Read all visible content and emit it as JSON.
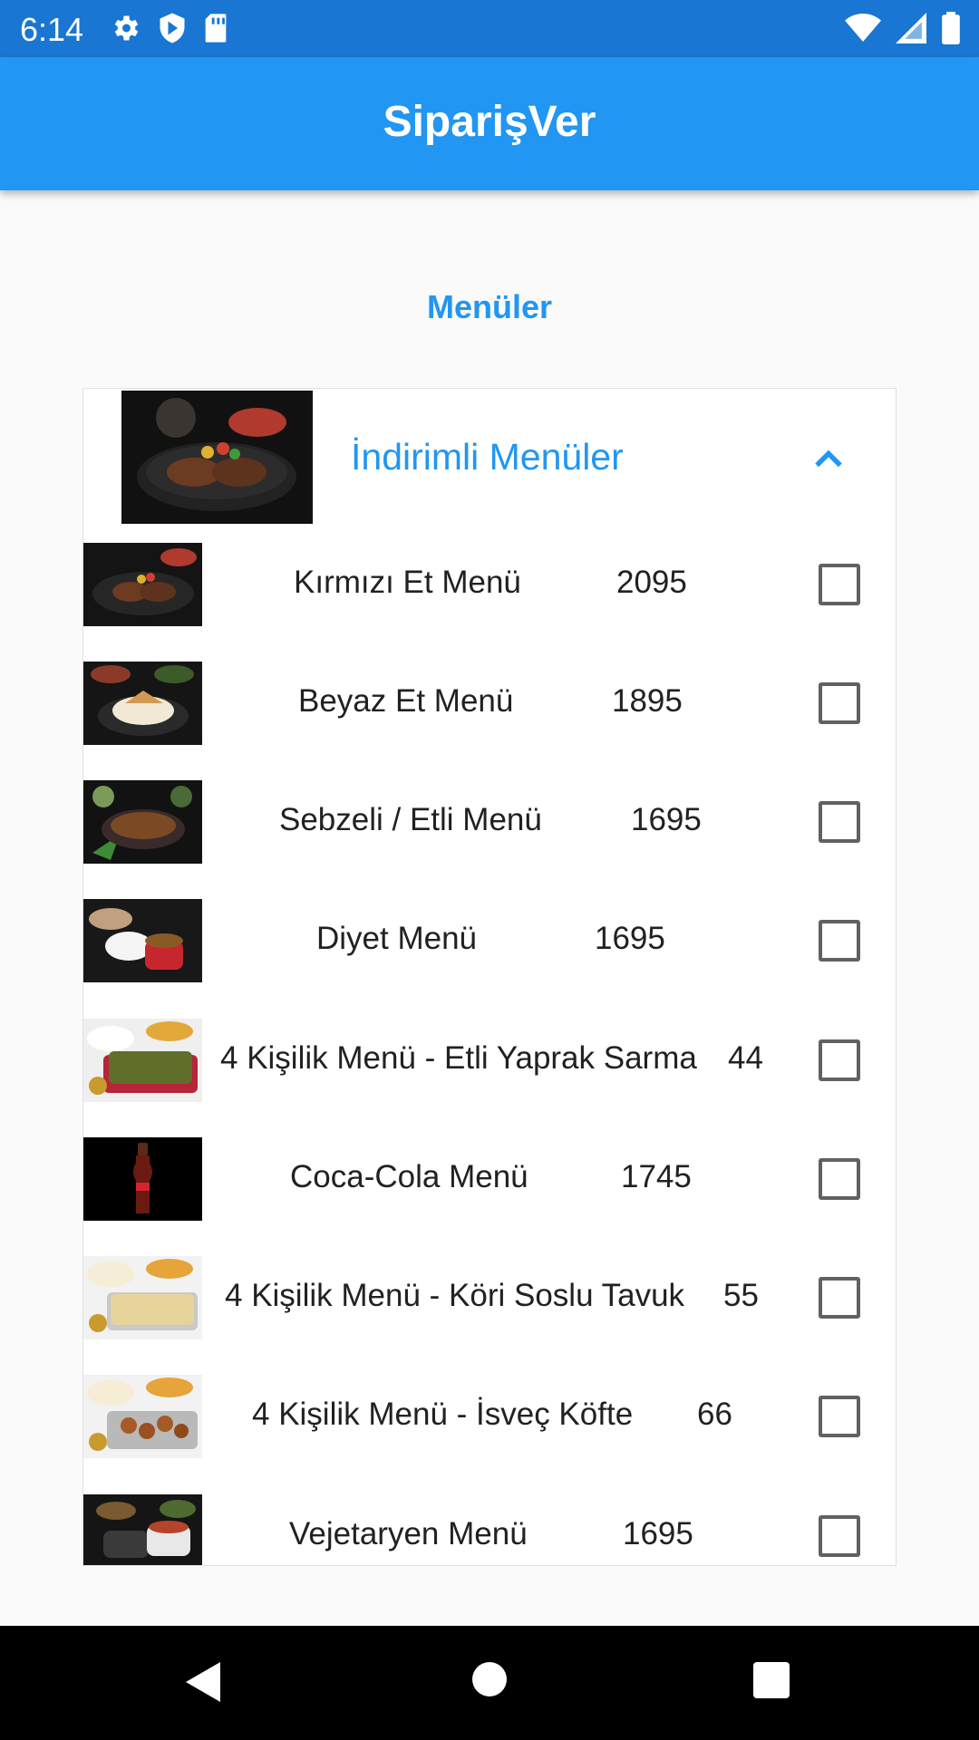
{
  "status_bar": {
    "time": "6:14",
    "left_icons": [
      "gear-icon",
      "shield-play-icon",
      "sd-card-icon"
    ],
    "right_icons": [
      "wifi-icon",
      "signal-icon",
      "battery-icon"
    ]
  },
  "app_bar": {
    "title": "SiparişVer",
    "color": "#2196f3"
  },
  "section": {
    "title": "Menüler"
  },
  "group": {
    "title": "İndirimli Menüler",
    "expanded": true,
    "icon": "chevron-up-icon"
  },
  "items": [
    {
      "label": "Kırmızı Et Menü",
      "price": "2095",
      "checked": false,
      "thumb": "steak"
    },
    {
      "label": "Beyaz Et Menü",
      "price": "1895",
      "checked": false,
      "thumb": "chicken-rice"
    },
    {
      "label": "Sebzeli / Etli Menü",
      "price": "1695",
      "checked": false,
      "thumb": "vegetable-meat"
    },
    {
      "label": "Diyet Menü",
      "price": "1695",
      "checked": false,
      "thumb": "diet"
    },
    {
      "label": "4 Kişilik Menü - Etli Yaprak Sarma",
      "price": "44",
      "checked": false,
      "thumb": "yaprak-sarma"
    },
    {
      "label": "Coca-Cola Menü",
      "price": "1745",
      "checked": false,
      "thumb": "coca-cola"
    },
    {
      "label": "4 Kişilik Menü - Köri Soslu Tavuk",
      "price": "55",
      "checked": false,
      "thumb": "curry-chicken"
    },
    {
      "label": "4 Kişilik Menü - İsveç Köfte",
      "price": "66",
      "checked": false,
      "thumb": "swedish-meatballs"
    },
    {
      "label": "Vejetaryen Menü",
      "price": "1695",
      "checked": false,
      "thumb": "vegetarian"
    }
  ],
  "nav_bar": {
    "icons": [
      "back-icon",
      "home-icon",
      "recents-icon"
    ]
  }
}
